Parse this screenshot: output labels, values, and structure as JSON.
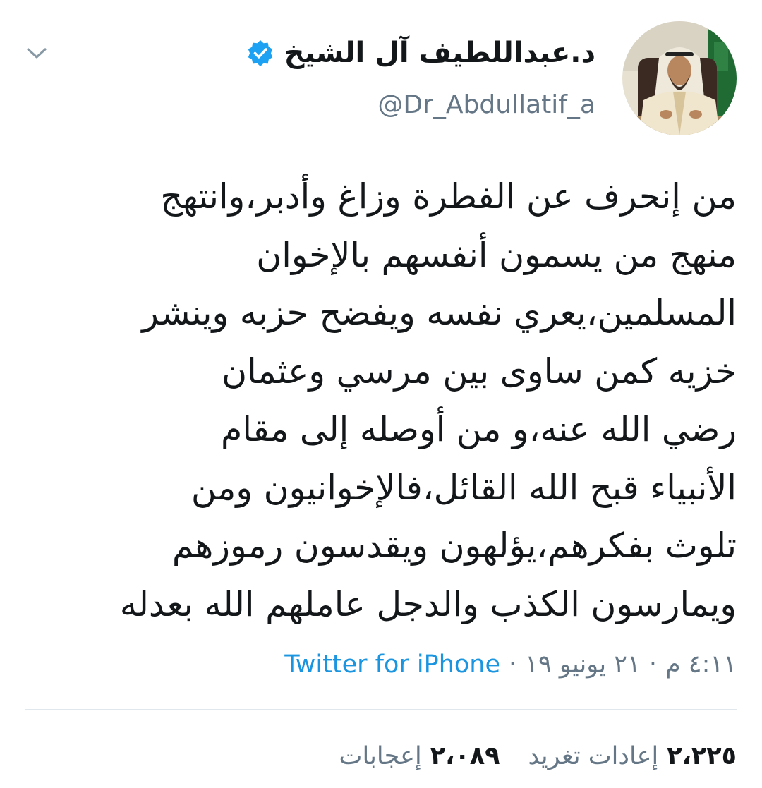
{
  "tweet": {
    "author_name": "د.عبداللطيف آل الشيخ",
    "author_handle": "@Dr_Abdullatif_a",
    "text": "من إنحرف عن الفطرة وزاغ وأدبر،وانتهج\nمنهج من يسمون أنفسهم بالإخوان\nالمسلمين،يعري نفسه ويفضح حزبه وينشر\nخزيه كمن ساوى بين مرسي وعثمان\nرضي الله عنه،و من أوصله إلى مقام\nالأنبياء قبح الله القائل،فالإخوانيون ومن\nتلوث بفكرهم،يؤلهون ويقدسون رموزهم\nويمارسون الكذب والدجل عاملهم الله بعدله",
    "time": "٤:١١ م",
    "date": "٢١ يونيو ١٩",
    "separator": "·",
    "source": "Twitter for iPhone"
  },
  "stats": {
    "retweets_count": "٢،٢٢٥",
    "retweets_label": "إعادات تغريد",
    "likes_count": "٢،٠٨٩",
    "likes_label": "إعجابات"
  },
  "icons": {
    "menu": "chevron-down-icon",
    "verified": "verified-badge-icon"
  },
  "colors": {
    "text": "#14171a",
    "secondary": "#657786",
    "link": "#1b95e0",
    "verified": "#1da1f2",
    "divider": "#e1e8ed"
  }
}
